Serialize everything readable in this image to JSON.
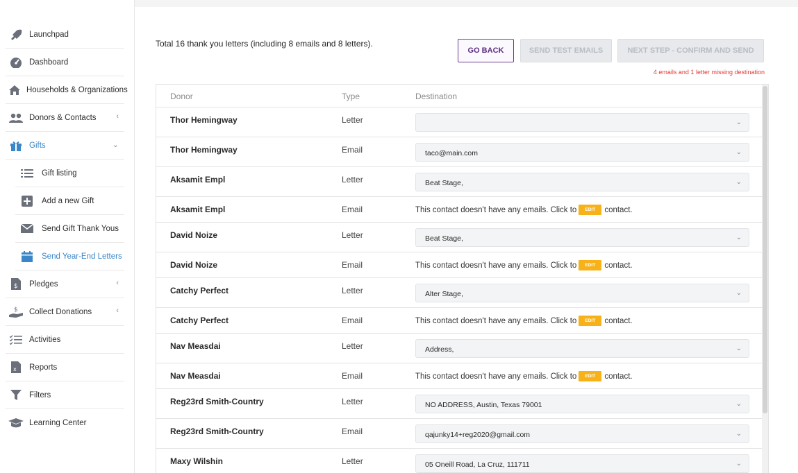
{
  "sidebar": {
    "items": [
      {
        "label": "Launchpad",
        "icon": "rocket-icon"
      },
      {
        "label": "Dashboard",
        "icon": "dashboard-icon"
      },
      {
        "label": "Households & Organizations",
        "icon": "house-icon"
      },
      {
        "label": "Donors & Contacts",
        "icon": "people-icon",
        "chevron": "<"
      },
      {
        "label": "Gifts",
        "icon": "gift-icon",
        "chevron": "v"
      },
      {
        "label": "Gift listing",
        "icon": "list-icon"
      },
      {
        "label": "Add a new Gift",
        "icon": "plus-square-icon"
      },
      {
        "label": "Send Gift Thank Yous",
        "icon": "envelope-icon"
      },
      {
        "label": "Send Year-End Letters",
        "icon": "calendar-icon"
      },
      {
        "label": "Pledges",
        "icon": "pledge-doc-icon",
        "chevron": "<"
      },
      {
        "label": "Collect Donations",
        "icon": "hand-dollar-icon",
        "chevron": "<"
      },
      {
        "label": "Activities",
        "icon": "checklist-icon"
      },
      {
        "label": "Reports",
        "icon": "report-icon"
      },
      {
        "label": "Filters",
        "icon": "filter-icon"
      },
      {
        "label": "Learning Center",
        "icon": "graduation-cap-icon"
      }
    ]
  },
  "header": {
    "total_text": "Total 16 thank you letters (including 8 emails and 8 letters).",
    "go_back": "GO BACK",
    "send_test": "SEND TEST EMAILS",
    "next_step": "NEXT STEP - CONFIRM AND SEND",
    "missing": "4 emails and 1 letter missing destination"
  },
  "table": {
    "columns": {
      "donor": "Donor",
      "type": "Type",
      "destination": "Destination"
    },
    "no_email_prefix": "This contact doesn't have any emails. Click to",
    "edit_label": "EDIT",
    "no_email_suffix": "contact.",
    "rows": [
      {
        "donor": "Thor Hemingway",
        "type": "Letter",
        "destination": ""
      },
      {
        "donor": "Thor Hemingway",
        "type": "Email",
        "destination": "taco@main.com"
      },
      {
        "donor": "Aksamit Empl",
        "type": "Letter",
        "destination": "Beat Stage,"
      },
      {
        "donor": "Aksamit Empl",
        "type": "Email"
      },
      {
        "donor": "David Noize",
        "type": "Letter",
        "destination": "Beat Stage,"
      },
      {
        "donor": "David Noize",
        "type": "Email"
      },
      {
        "donor": "Catchy Perfect",
        "type": "Letter",
        "destination": "Alter Stage,"
      },
      {
        "donor": "Catchy Perfect",
        "type": "Email"
      },
      {
        "donor": "Nav Measdai",
        "type": "Letter",
        "destination": "Address,"
      },
      {
        "donor": "Nav Measdai",
        "type": "Email"
      },
      {
        "donor": "Reg23rd Smith-Country",
        "type": "Letter",
        "destination": "NO ADDRESS, Austin, Texas 79001"
      },
      {
        "donor": "Reg23rd Smith-Country",
        "type": "Email",
        "destination": "qajunky14+reg2020@gmail.com"
      },
      {
        "donor": "Maxy Wilshin",
        "type": "Letter",
        "destination": "05 Oneill Road, La Cruz, 111711"
      }
    ]
  },
  "colors": {
    "accent_purple": "#5b2d82",
    "active_blue": "#3a86c8",
    "warning_red": "#e53935",
    "edit_orange": "#f7b21a"
  }
}
